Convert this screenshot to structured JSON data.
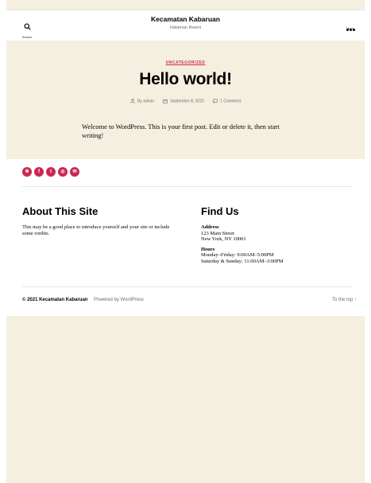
{
  "header": {
    "search_label": "Search",
    "site_title": "Kecamatan Kabaruan",
    "site_description": "Halaman Resmi",
    "menu_label": "Menu"
  },
  "post": {
    "category": "UNCATEGORIZED",
    "title": "Hello world!",
    "author": "By admin",
    "date": "September 8, 2020",
    "comments": "1 Comment",
    "content": "Welcome to WordPress. This is your first post. Edit or delete it, then start writing!"
  },
  "social": [
    "yelp-icon",
    "facebook-icon",
    "twitter-icon",
    "instagram-icon",
    "email-icon"
  ],
  "widgets": {
    "about_title": "About This Site",
    "about_text": "This may be a good place to introduce yourself and your site or include some credits.",
    "find_title": "Find Us",
    "address_label": "Address",
    "address_line1": "123 Main Street",
    "address_line2": "New York, NY 10001",
    "hours_label": "Hours",
    "hours_line1": "Monday–Friday: 9:00AM–5:00PM",
    "hours_line2": "Saturday & Sunday: 11:00AM–3:00PM"
  },
  "footer": {
    "copyright": "© 2021 Kecamatan Kabaruan",
    "powered": "Powered by WordPress",
    "to_top": "To the top ↑"
  },
  "colors": {
    "accent": "#cd2653",
    "background": "#f5efe0",
    "muted": "#6d6d6d"
  }
}
